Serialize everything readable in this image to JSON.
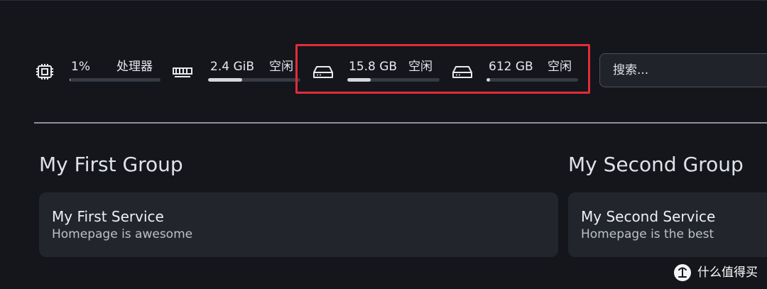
{
  "resource_widgets": [
    {
      "name": "cpu",
      "icon": "cpu-icon",
      "value": "1%",
      "label": "处理器",
      "usage_percent": 1
    },
    {
      "name": "memory",
      "icon": "memory-icon",
      "value": "2.4 GiB",
      "label": "空闲",
      "usage_percent": 37
    },
    {
      "name": "disk-1",
      "icon": "disk-icon",
      "value": "15.8 GB",
      "label": "空闲",
      "usage_percent": 25
    },
    {
      "name": "disk-2",
      "icon": "disk-icon",
      "value": "612 GB",
      "label": "空闲",
      "usage_percent": 4
    }
  ],
  "search": {
    "placeholder": "搜索..."
  },
  "groups": [
    {
      "title": "My First Group",
      "services": [
        {
          "title": "My First Service",
          "description": "Homepage is awesome"
        }
      ]
    },
    {
      "title": "My Second Group",
      "services": [
        {
          "title": "My Second Service",
          "description": "Homepage is the best"
        }
      ]
    }
  ],
  "watermark": {
    "text": "什么值得买"
  },
  "colors": {
    "background": "#14161b",
    "card": "#22252c",
    "highlight": "#e32b3a",
    "bar_track": "#353a43",
    "bar_fill": "#d6d8dd"
  }
}
